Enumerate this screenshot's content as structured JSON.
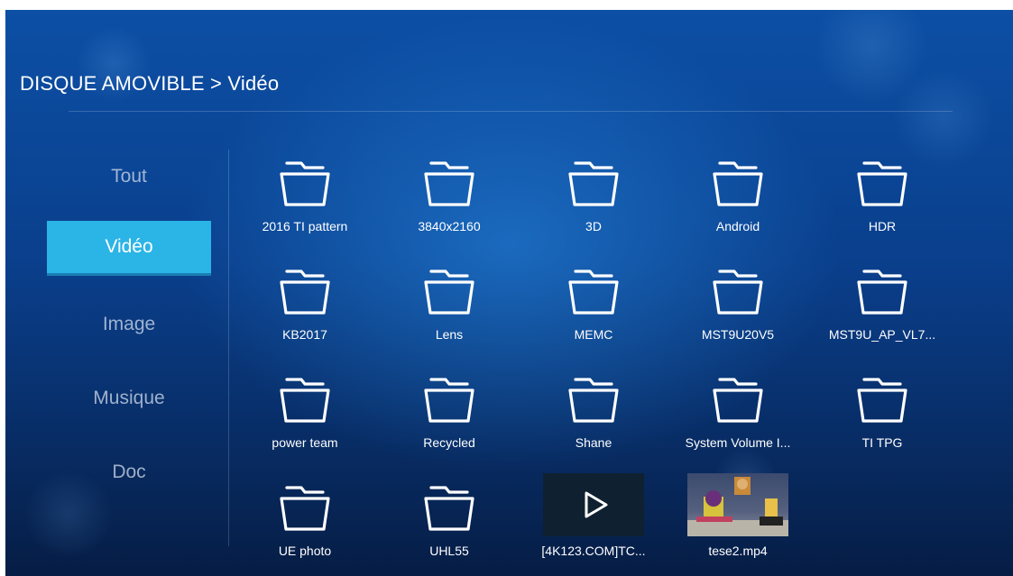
{
  "header": {
    "breadcrumb": "DISQUE AMOVIBLE > Vidéo"
  },
  "sidebar": {
    "items": [
      {
        "label": "Tout",
        "active": false
      },
      {
        "label": "Vidéo",
        "active": true
      },
      {
        "label": "Image",
        "active": false
      },
      {
        "label": "Musique",
        "active": false
      },
      {
        "label": "Doc",
        "active": false
      }
    ]
  },
  "grid": {
    "items": [
      {
        "label": "2016 TI pattern",
        "icon": "folder-icon"
      },
      {
        "label": "3840x2160",
        "icon": "folder-icon"
      },
      {
        "label": "3D",
        "icon": "folder-icon"
      },
      {
        "label": "Android",
        "icon": "folder-icon"
      },
      {
        "label": "HDR",
        "icon": "folder-icon"
      },
      {
        "label": "KB2017",
        "icon": "folder-icon"
      },
      {
        "label": "Lens",
        "icon": "folder-icon"
      },
      {
        "label": "MEMC",
        "icon": "folder-icon"
      },
      {
        "label": "MST9U20V5",
        "icon": "folder-icon"
      },
      {
        "label": "MST9U_AP_VL7...",
        "icon": "folder-icon"
      },
      {
        "label": "power team",
        "icon": "folder-icon"
      },
      {
        "label": "Recycled",
        "icon": "folder-icon"
      },
      {
        "label": "Shane",
        "icon": "folder-icon"
      },
      {
        "label": "System Volume I...",
        "icon": "folder-icon"
      },
      {
        "label": "TI TPG",
        "icon": "folder-icon"
      },
      {
        "label": "UE photo",
        "icon": "folder-icon"
      },
      {
        "label": "UHL55",
        "icon": "folder-icon"
      },
      {
        "label": "[4K123.COM]TC...",
        "icon": "play-icon"
      },
      {
        "label": "tese2.mp4",
        "icon": "video-thumbnail"
      }
    ]
  },
  "colors": {
    "accent": "#2bb4e6",
    "background": "#0a3f8c"
  }
}
